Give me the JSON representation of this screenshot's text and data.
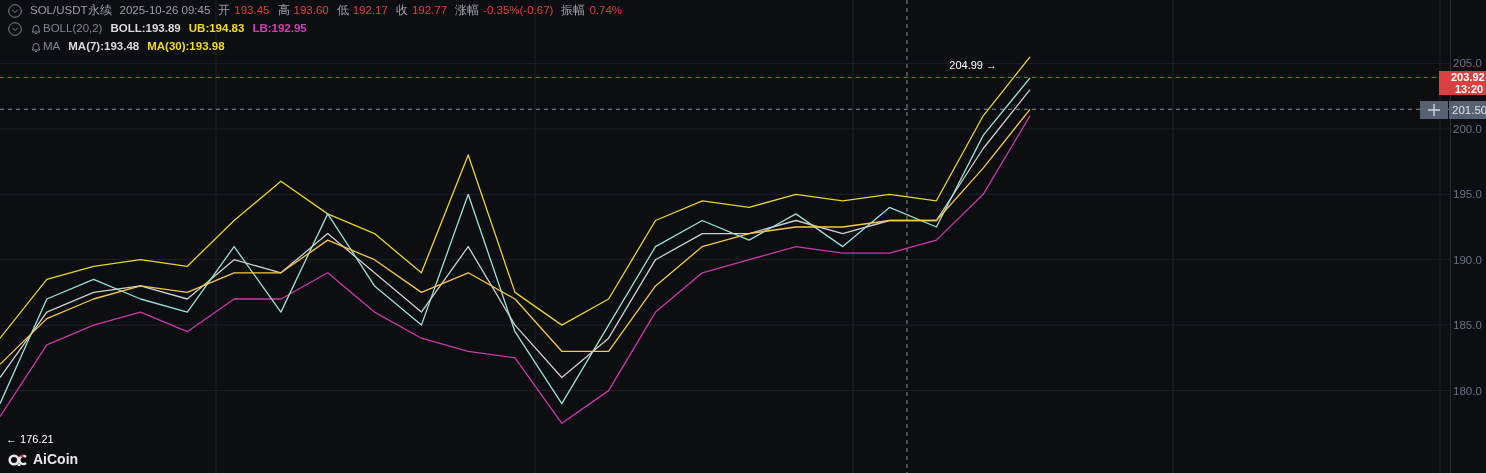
{
  "header": {
    "symbol": "SOL/USDT永续",
    "time": "2025-10-26 09:45",
    "stats": [
      {
        "label": "开",
        "value": "193.45"
      },
      {
        "label": "高",
        "value": "193.60"
      },
      {
        "label": "低",
        "value": "192.17"
      },
      {
        "label": "收",
        "value": "192.77"
      },
      {
        "label": "涨幅",
        "value": "-0.35%(-0.67)"
      },
      {
        "label": "振幅",
        "value": "0.74%"
      }
    ]
  },
  "indicators": [
    {
      "name": "BOLL(20,2)",
      "collapsible": true,
      "values": [
        {
          "text": "BOLL:193.89",
          "color": "#d9d9d9"
        },
        {
          "text": "UB:194.83",
          "color": "#f0dc1e"
        },
        {
          "text": "LB:192.95",
          "color": "#d83cb4"
        }
      ]
    },
    {
      "name": "MA",
      "collapsible": false,
      "values": [
        {
          "text": "MA(7):193.48",
          "color": "#d9d9d9"
        },
        {
          "text": "MA(30):193.98",
          "color": "#f0dc1e"
        }
      ]
    }
  ],
  "chart_data": {
    "type": "line",
    "grid": true,
    "ylim": [
      173.7,
      209.85
    ],
    "ref_lines": [
      {
        "axis": "y",
        "value": 203.92,
        "color": "#d9403f"
      },
      {
        "axis": "y",
        "value": 201.5,
        "color": "#8a8d93"
      }
    ],
    "yticks": [
      {
        "value": 205,
        "label": "205.0"
      },
      {
        "value": 200,
        "label": "200.0"
      },
      {
        "value": 195,
        "label": "195.0"
      },
      {
        "value": 190,
        "label": "190.0"
      },
      {
        "value": 185,
        "label": "185.0"
      },
      {
        "value": 180,
        "label": "180.0"
      }
    ],
    "series": [
      {
        "color": "#e8d42a",
        "values": [
          184,
          188.5,
          189.5,
          190,
          189.5,
          193,
          196,
          193.5,
          192,
          189,
          198,
          187.5,
          185,
          187,
          193,
          194.5,
          194,
          195,
          194.5,
          195,
          194.5,
          201,
          205.5
        ]
      },
      {
        "color": "#cfcfcf",
        "values": [
          181,
          186,
          187.5,
          188,
          187,
          190,
          189,
          192,
          189,
          186,
          191,
          185,
          181,
          184,
          190,
          192,
          192,
          193,
          192,
          193,
          193,
          198.5,
          203
        ]
      },
      {
        "color": "#c93aa6",
        "values": [
          178,
          183.5,
          185,
          186,
          184.5,
          187,
          187,
          189,
          186,
          184,
          183,
          182.5,
          177.5,
          180,
          186,
          189,
          190,
          191,
          190.5,
          190.5,
          191.5,
          195,
          201
        ]
      },
      {
        "color": "#9fe0d0",
        "values": [
          179,
          187,
          188.5,
          187,
          186,
          191,
          186,
          193.5,
          188,
          185,
          195,
          184.5,
          179,
          185,
          191,
          193,
          191.5,
          193.5,
          191,
          194,
          192.5,
          199.5,
          203.9
        ]
      },
      {
        "color": "#f2c94c",
        "values": [
          182,
          185.5,
          187,
          188,
          187.5,
          189,
          189,
          191.5,
          190,
          187.5,
          189,
          187,
          183,
          183,
          188,
          191,
          192,
          192.5,
          192.5,
          193,
          193,
          197,
          201.5
        ]
      }
    ],
    "annotations": [
      "204.99 →",
      "← 176.21"
    ]
  },
  "last_price": {
    "value": "203.92",
    "countdown": "13:20"
  },
  "crosshair": {
    "value": "201.50"
  },
  "logo": {
    "text": "AiCoin"
  }
}
